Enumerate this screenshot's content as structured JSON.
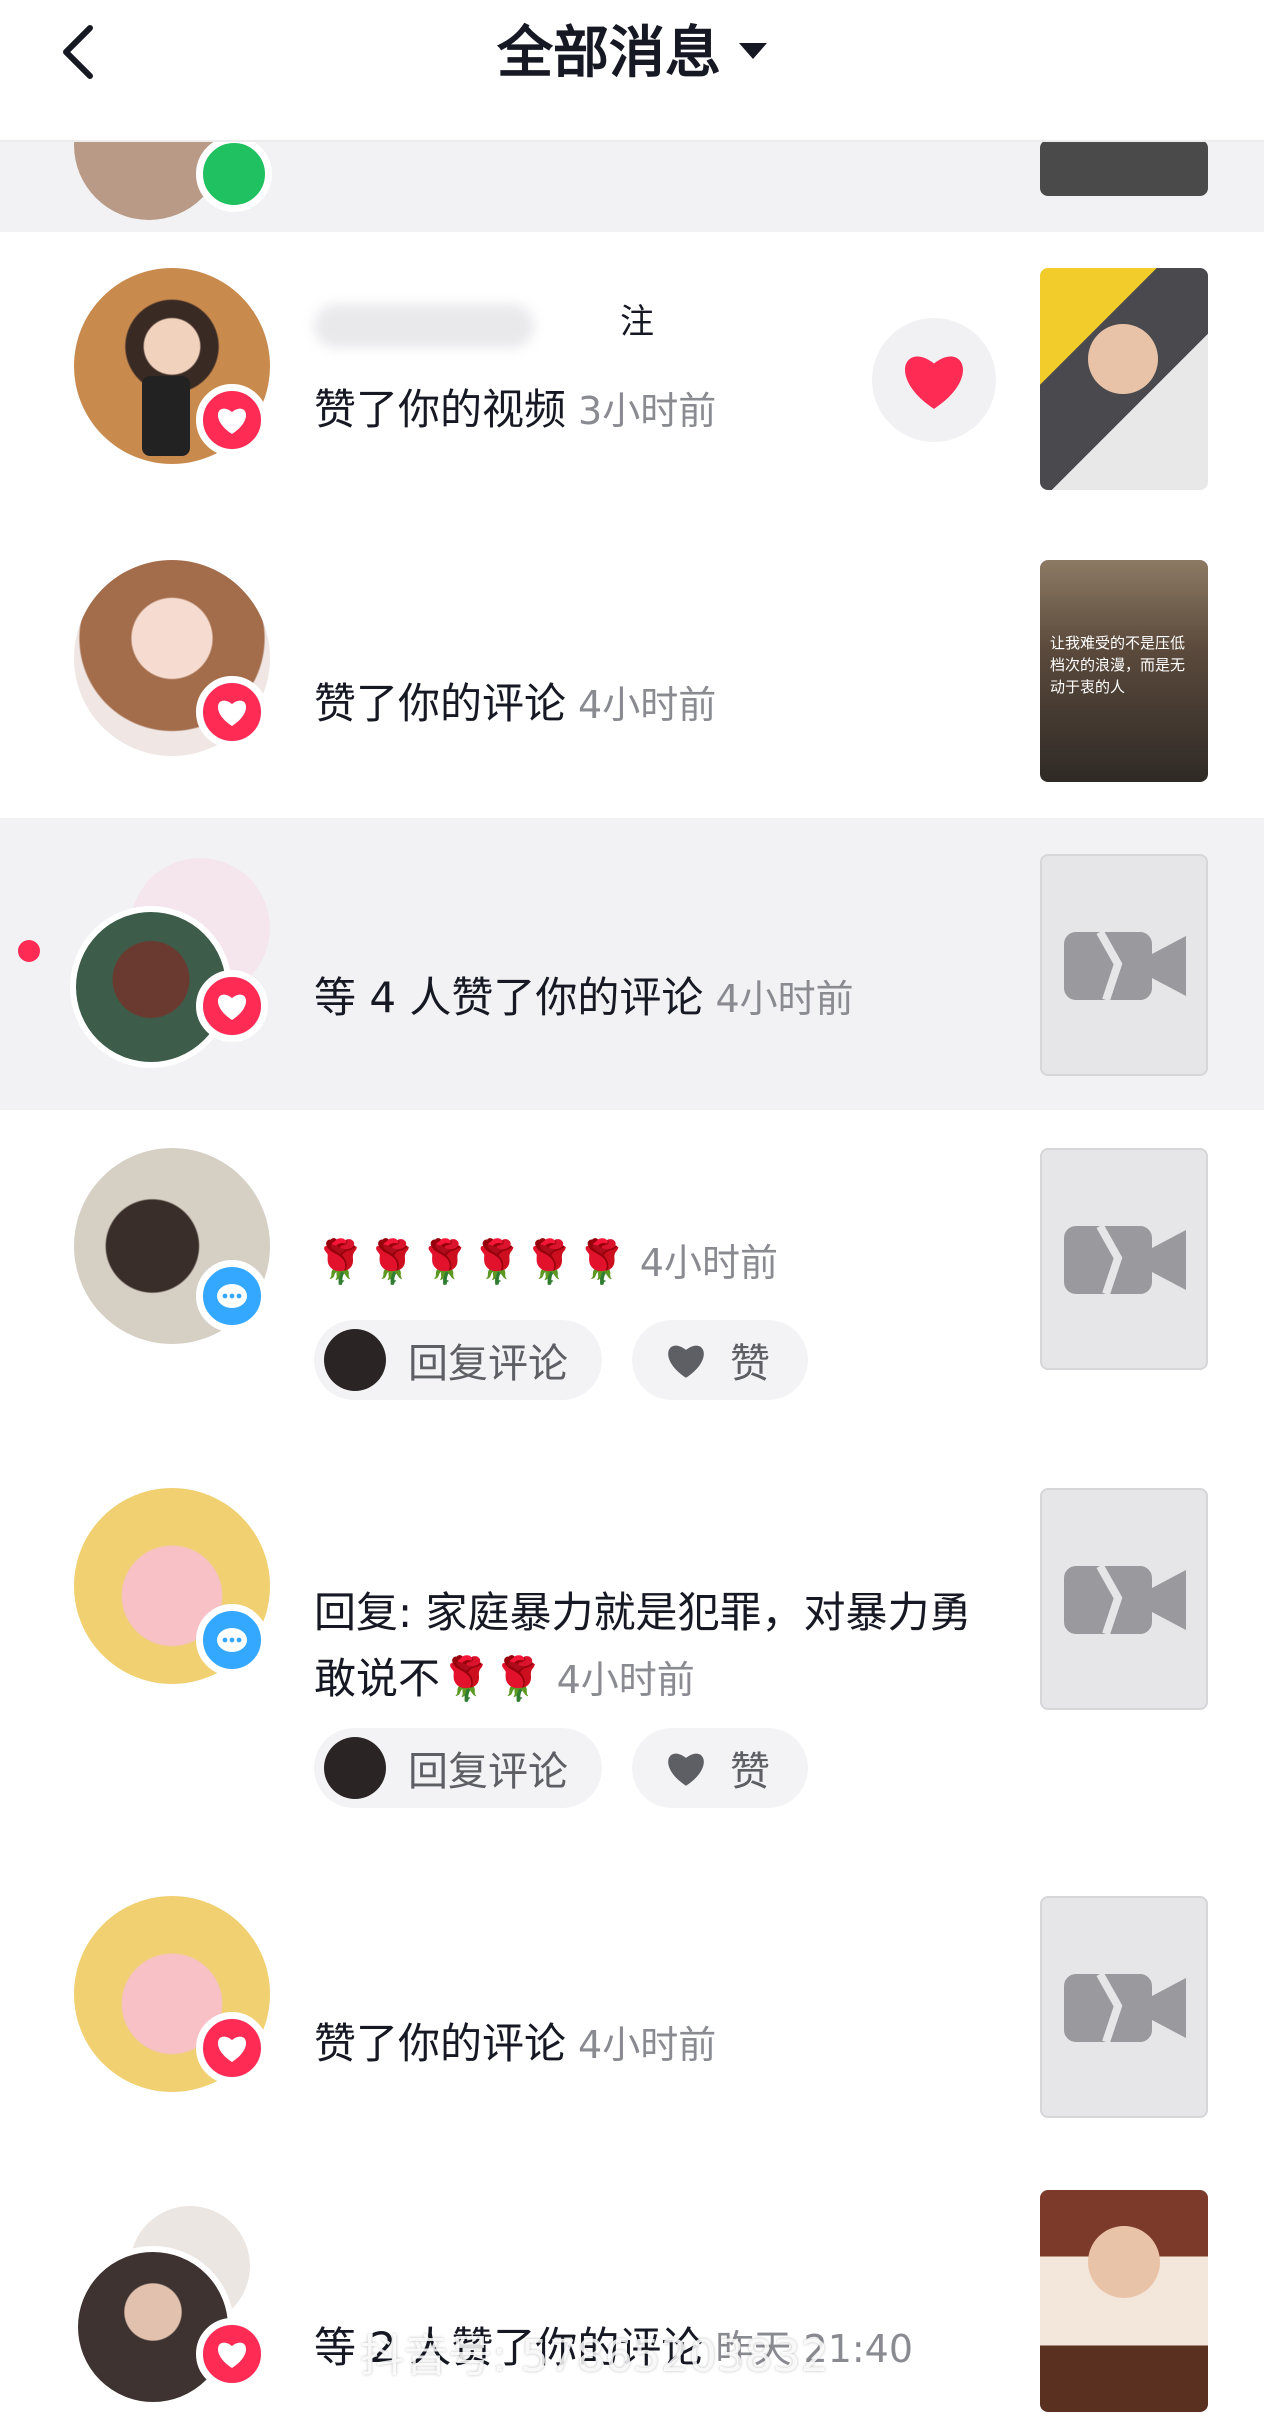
{
  "header": {
    "title": "全部消息"
  },
  "notifications": [
    {
      "action": "赞了你的视频",
      "time": "3小时前",
      "name_fragment": "注"
    },
    {
      "action": "赞了你的评论",
      "time": "4小时前"
    },
    {
      "action": "等 4 人赞了你的评论",
      "time": "4小时前"
    },
    {
      "action": "🌹🌹🌹🌹🌹🌹",
      "time": "4小时前"
    },
    {
      "action": "回复: 家庭暴力就是犯罪，对暴力勇敢说不🌹🌹",
      "time": "4小时前"
    },
    {
      "action": "赞了你的评论",
      "time": "4小时前"
    },
    {
      "action": "等 2 人赞了你的评论",
      "time": "昨天 21:40"
    }
  ],
  "actions": {
    "reply_label": "回复评论",
    "like_label": "赞"
  },
  "thumbnails": {
    "row2_text": "让我难受的不是压低档次的浪漫，而是无动于衷的人"
  },
  "watermark": "抖音号: 57865203832",
  "colors": {
    "like_red": "#fe2c55",
    "comment_blue": "#34a8ff",
    "time_gray": "#8a8b91",
    "highlight_bg": "#f2f2f4"
  }
}
